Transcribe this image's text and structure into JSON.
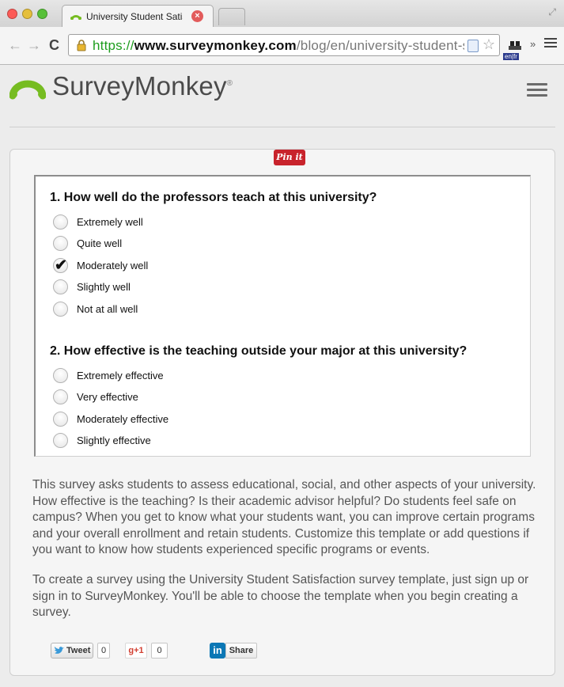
{
  "browser": {
    "tab_title": "University Student Satisfac",
    "url_scheme": "https://",
    "url_host": "www.surveymonkey.com",
    "url_path": "/blog/en/university-student-sati…",
    "extension_label": "en|fr"
  },
  "header": {
    "logo_text": "SurveyMonkey",
    "logo_reg": "®",
    "brand_color": "#76bc21"
  },
  "survey": {
    "questions": [
      {
        "title": "1. How well do the professors teach at this university?",
        "options": [
          {
            "label": "Extremely well",
            "selected": false
          },
          {
            "label": "Quite well",
            "selected": false
          },
          {
            "label": "Moderately well",
            "selected": true
          },
          {
            "label": "Slightly well",
            "selected": false
          },
          {
            "label": "Not at all well",
            "selected": false
          }
        ]
      },
      {
        "title": "2. How effective is the teaching outside your major at this university?",
        "options": [
          {
            "label": "Extremely effective",
            "selected": false
          },
          {
            "label": "Very effective",
            "selected": false
          },
          {
            "label": "Moderately effective",
            "selected": false
          },
          {
            "label": "Slightly effective",
            "selected": false
          }
        ]
      }
    ]
  },
  "description": {
    "paragraph1": "This survey asks students to assess educational, social, and other aspects of your university. How effective is the teaching? Is their academic advisor helpful? Do students feel safe on campus? When you get to know what your students want, you can improve certain programs and your overall enrollment and retain students. Customize this template or add questions if you want to know how students experienced specific programs or events.",
    "paragraph2": "To create a survey using the University Student Satisfaction survey template, just sign up or sign in to SurveyMonkey. You'll be able to choose the template when you begin creating a survey."
  },
  "share": {
    "tweet_label": "Tweet",
    "tweet_count": "0",
    "gplus_label": "g+1",
    "gplus_count": "0",
    "linkedin_logo": "in",
    "linkedin_label": "Share",
    "pinterest_label": "Pin it"
  }
}
